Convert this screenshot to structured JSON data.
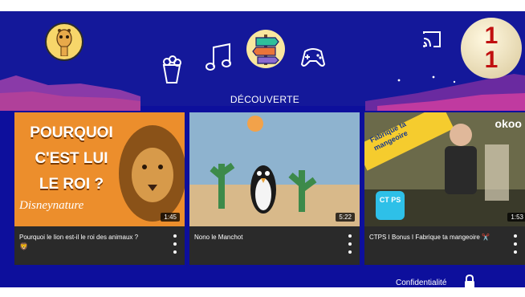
{
  "header": {
    "section_title": "DÉCOUVERTE",
    "counter_top": "1",
    "counter_bottom": "1"
  },
  "icons": {
    "avatar": "giraffe-avatar-icon",
    "categories": [
      "popcorn-icon",
      "music-notes-icon",
      "discovery-signpost-icon",
      "gamepad-icon"
    ],
    "cast": "cast-icon",
    "lock": "lock-icon"
  },
  "videos": [
    {
      "title": "Pourquoi le lion est-il le roi des animaux ?",
      "duration": "1:45",
      "thumb_text": [
        "POURQUOI",
        "C'EST LUI",
        "LE ROI ?"
      ],
      "thumb_brand": "Disneynature"
    },
    {
      "title": "Nono le Manchot",
      "duration": "5:22"
    },
    {
      "title": "CTPS I Bonus I Fabrique ta mangeoire ✂️",
      "duration": "1:53",
      "thumb_banner": "Fabrique ta mangeoire",
      "thumb_brand": "okoo",
      "thumb_badge": "CT PS"
    }
  ],
  "footer": {
    "privacy_label": "Confidentialité"
  },
  "colors": {
    "background": "#0d0f9c",
    "card": "#2a2a2a",
    "counter": "#c01010"
  }
}
